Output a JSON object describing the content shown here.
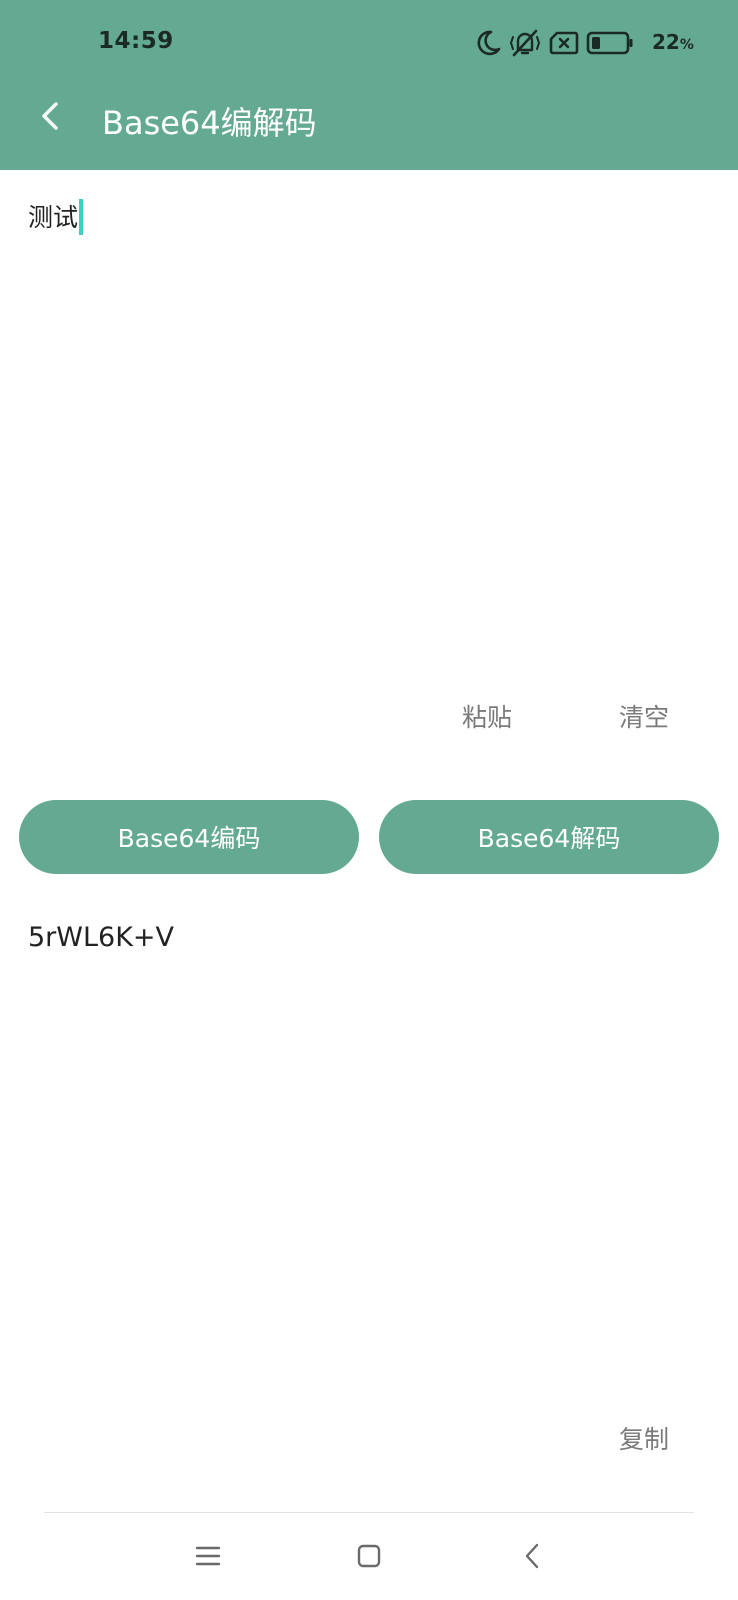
{
  "status_bar": {
    "time": "14:59",
    "icons": [
      "moon-icon",
      "mute-vibrate-icon",
      "no-sim-icon",
      "battery-icon"
    ],
    "battery_percent": "22",
    "battery_suffix": "%"
  },
  "header": {
    "title": "Base64编解码",
    "back_icon": "chevron-left-icon",
    "background_color": "#64aa92"
  },
  "input": {
    "value": "测试",
    "paste_label": "粘贴",
    "clear_label": "清空"
  },
  "actions": {
    "encode_label": "Base64编码",
    "decode_label": "Base64解码",
    "button_color": "#64aa92"
  },
  "output": {
    "value": "5rWL6K+V",
    "copy_label": "复制"
  },
  "nav_bar": {
    "icons": [
      "menu-icon",
      "home-icon",
      "back-icon"
    ]
  }
}
